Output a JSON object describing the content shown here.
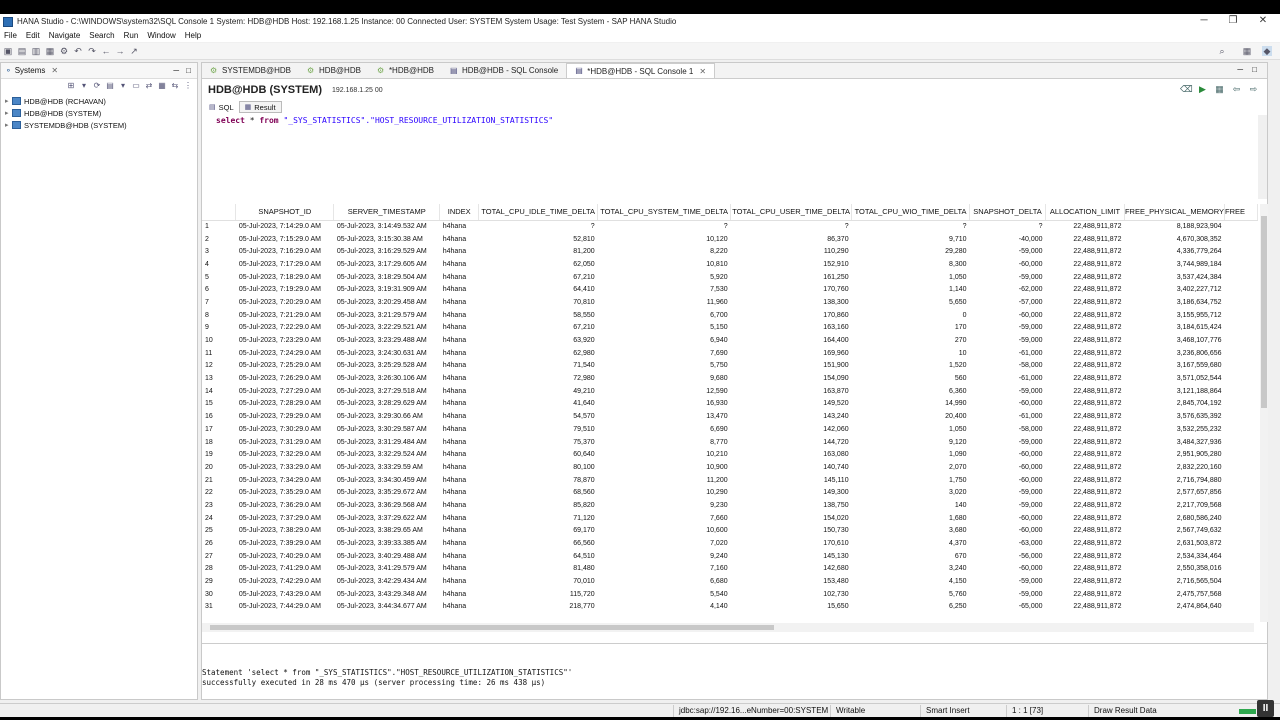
{
  "window": {
    "title": "HANA Studio - C:\\WINDOWS\\system32\\SQL Console 1 System: HDB@HDB Host: 192.168.1.25 Instance: 00 Connected User: SYSTEM System Usage: Test System - SAP HANA Studio",
    "controls": {
      "minimize": "─",
      "restore": "❐",
      "close": "✕"
    }
  },
  "menu": [
    "File",
    "Edit",
    "Navigate",
    "Search",
    "Run",
    "Window",
    "Help"
  ],
  "systems_panel": {
    "title": "Systems",
    "items": [
      "HDB@HDB (RCHAVAN)",
      "HDB@HDB (SYSTEM)",
      "SYSTEMDB@HDB (SYSTEM)"
    ]
  },
  "editor_tabs": [
    {
      "label": "SYSTEMDB@HDB"
    },
    {
      "label": "HDB@HDB"
    },
    {
      "label": "*HDB@HDB"
    },
    {
      "label": "HDB@HDB - SQL Console"
    },
    {
      "label": "*HDB@HDB - SQL Console 1",
      "active": true
    }
  ],
  "console": {
    "system": "HDB@HDB (SYSTEM)",
    "host": "192.168.1.25 00",
    "subtabs": {
      "sql": "SQL",
      "result": "Result"
    },
    "sql": {
      "select": "select",
      "star": " * ",
      "from": "from",
      "target": " \"_SYS_STATISTICS\".\"HOST_RESOURCE_UTILIZATION_STATISTICS\""
    }
  },
  "result": {
    "columns": [
      "SNAPSHOT_ID",
      "SERVER_TIMESTAMP",
      "INDEX",
      "TOTAL_CPU_IDLE_TIME_DELTA",
      "TOTAL_CPU_SYSTEM_TIME_DELTA",
      "TOTAL_CPU_USER_TIME_DELTA",
      "TOTAL_CPU_WIO_TIME_DELTA",
      "SNAPSHOT_DELTA",
      "ALLOCATION_LIMIT",
      "FREE_PHYSICAL_MEMORY",
      "FREE"
    ],
    "rows": [
      [
        "1",
        "05-Jul-2023, 7:14:29.0 AM",
        "05-Jul-2023, 3:14:49.532 AM",
        "h4hana",
        "?",
        "?",
        "?",
        "?",
        "?",
        "22,488,911,872",
        "8,188,923,904"
      ],
      [
        "2",
        "05-Jul-2023, 7:15:29.0 AM",
        "05-Jul-2023, 3:15:30.38 AM",
        "h4hana",
        "52,810",
        "10,120",
        "86,370",
        "9,710",
        "-40,000",
        "22,488,911,872",
        "4,670,308,352"
      ],
      [
        "3",
        "05-Jul-2023, 7:16:29.0 AM",
        "05-Jul-2023, 3:16:29.529 AM",
        "h4hana",
        "81,200",
        "8,220",
        "110,290",
        "29,280",
        "-59,000",
        "22,488,911,872",
        "4,336,779,264"
      ],
      [
        "4",
        "05-Jul-2023, 7:17:29.0 AM",
        "05-Jul-2023, 3:17:29.605 AM",
        "h4hana",
        "62,050",
        "10,810",
        "152,910",
        "8,300",
        "-60,000",
        "22,488,911,872",
        "3,744,989,184"
      ],
      [
        "5",
        "05-Jul-2023, 7:18:29.0 AM",
        "05-Jul-2023, 3:18:29.504 AM",
        "h4hana",
        "67,210",
        "5,920",
        "161,250",
        "1,050",
        "-59,000",
        "22,488,911,872",
        "3,537,424,384"
      ],
      [
        "6",
        "05-Jul-2023, 7:19:29.0 AM",
        "05-Jul-2023, 3:19:31.909 AM",
        "h4hana",
        "64,410",
        "7,530",
        "170,760",
        "1,140",
        "-62,000",
        "22,488,911,872",
        "3,402,227,712"
      ],
      [
        "7",
        "05-Jul-2023, 7:20:29.0 AM",
        "05-Jul-2023, 3:20:29.458 AM",
        "h4hana",
        "70,810",
        "11,960",
        "138,300",
        "5,650",
        "-57,000",
        "22,488,911,872",
        "3,186,634,752"
      ],
      [
        "8",
        "05-Jul-2023, 7:21:29.0 AM",
        "05-Jul-2023, 3:21:29.579 AM",
        "h4hana",
        "58,550",
        "6,700",
        "170,860",
        "0",
        "-60,000",
        "22,488,911,872",
        "3,155,955,712"
      ],
      [
        "9",
        "05-Jul-2023, 7:22:29.0 AM",
        "05-Jul-2023, 3:22:29.521 AM",
        "h4hana",
        "67,210",
        "5,150",
        "163,160",
        "170",
        "-59,000",
        "22,488,911,872",
        "3,184,615,424"
      ],
      [
        "10",
        "05-Jul-2023, 7:23:29.0 AM",
        "05-Jul-2023, 3:23:29.488 AM",
        "h4hana",
        "63,920",
        "6,940",
        "164,400",
        "270",
        "-59,000",
        "22,488,911,872",
        "3,468,107,776"
      ],
      [
        "11",
        "05-Jul-2023, 7:24:29.0 AM",
        "05-Jul-2023, 3:24:30.631 AM",
        "h4hana",
        "62,980",
        "7,690",
        "169,960",
        "10",
        "-61,000",
        "22,488,911,872",
        "3,236,806,656"
      ],
      [
        "12",
        "05-Jul-2023, 7:25:29.0 AM",
        "05-Jul-2023, 3:25:29.528 AM",
        "h4hana",
        "71,540",
        "5,750",
        "151,900",
        "1,520",
        "-58,000",
        "22,488,911,872",
        "3,167,559,680"
      ],
      [
        "13",
        "05-Jul-2023, 7:26:29.0 AM",
        "05-Jul-2023, 3:26:30.106 AM",
        "h4hana",
        "72,980",
        "9,680",
        "154,090",
        "560",
        "-61,000",
        "22,488,911,872",
        "3,571,052,544"
      ],
      [
        "14",
        "05-Jul-2023, 7:27:29.0 AM",
        "05-Jul-2023, 3:27:29.518 AM",
        "h4hana",
        "49,210",
        "12,590",
        "163,870",
        "6,360",
        "-59,000",
        "22,488,911,872",
        "3,121,188,864"
      ],
      [
        "15",
        "05-Jul-2023, 7:28:29.0 AM",
        "05-Jul-2023, 3:28:29.629 AM",
        "h4hana",
        "41,640",
        "16,930",
        "149,520",
        "14,990",
        "-60,000",
        "22,488,911,872",
        "2,845,704,192"
      ],
      [
        "16",
        "05-Jul-2023, 7:29:29.0 AM",
        "05-Jul-2023, 3:29:30.66 AM",
        "h4hana",
        "54,570",
        "13,470",
        "143,240",
        "20,400",
        "-61,000",
        "22,488,911,872",
        "3,576,635,392"
      ],
      [
        "17",
        "05-Jul-2023, 7:30:29.0 AM",
        "05-Jul-2023, 3:30:29.587 AM",
        "h4hana",
        "79,510",
        "6,690",
        "142,060",
        "1,050",
        "-58,000",
        "22,488,911,872",
        "3,532,255,232"
      ],
      [
        "18",
        "05-Jul-2023, 7:31:29.0 AM",
        "05-Jul-2023, 3:31:29.484 AM",
        "h4hana",
        "75,370",
        "8,770",
        "144,720",
        "9,120",
        "-59,000",
        "22,488,911,872",
        "3,484,327,936"
      ],
      [
        "19",
        "05-Jul-2023, 7:32:29.0 AM",
        "05-Jul-2023, 3:32:29.524 AM",
        "h4hana",
        "60,640",
        "10,210",
        "163,080",
        "1,090",
        "-60,000",
        "22,488,911,872",
        "2,951,905,280"
      ],
      [
        "20",
        "05-Jul-2023, 7:33:29.0 AM",
        "05-Jul-2023, 3:33:29.59 AM",
        "h4hana",
        "80,100",
        "10,900",
        "140,740",
        "2,070",
        "-60,000",
        "22,488,911,872",
        "2,832,220,160"
      ],
      [
        "21",
        "05-Jul-2023, 7:34:29.0 AM",
        "05-Jul-2023, 3:34:30.459 AM",
        "h4hana",
        "78,870",
        "11,200",
        "145,110",
        "1,750",
        "-60,000",
        "22,488,911,872",
        "2,716,794,880"
      ],
      [
        "22",
        "05-Jul-2023, 7:35:29.0 AM",
        "05-Jul-2023, 3:35:29.672 AM",
        "h4hana",
        "68,560",
        "10,290",
        "149,300",
        "3,020",
        "-59,000",
        "22,488,911,872",
        "2,577,657,856"
      ],
      [
        "23",
        "05-Jul-2023, 7:36:29.0 AM",
        "05-Jul-2023, 3:36:29.568 AM",
        "h4hana",
        "85,820",
        "9,230",
        "138,750",
        "140",
        "-59,000",
        "22,488,911,872",
        "2,217,709,568"
      ],
      [
        "24",
        "05-Jul-2023, 7:37:29.0 AM",
        "05-Jul-2023, 3:37:29.622 AM",
        "h4hana",
        "71,120",
        "7,660",
        "154,020",
        "1,680",
        "-60,000",
        "22,488,911,872",
        "2,680,586,240"
      ],
      [
        "25",
        "05-Jul-2023, 7:38:29.0 AM",
        "05-Jul-2023, 3:38:29.65 AM",
        "h4hana",
        "69,170",
        "10,600",
        "150,730",
        "3,680",
        "-60,000",
        "22,488,911,872",
        "2,567,749,632"
      ],
      [
        "26",
        "05-Jul-2023, 7:39:29.0 AM",
        "05-Jul-2023, 3:39:33.385 AM",
        "h4hana",
        "66,560",
        "7,020",
        "170,610",
        "4,370",
        "-63,000",
        "22,488,911,872",
        "2,631,503,872"
      ],
      [
        "27",
        "05-Jul-2023, 7:40:29.0 AM",
        "05-Jul-2023, 3:40:29.488 AM",
        "h4hana",
        "64,510",
        "9,240",
        "145,130",
        "670",
        "-56,000",
        "22,488,911,872",
        "2,534,334,464"
      ],
      [
        "28",
        "05-Jul-2023, 7:41:29.0 AM",
        "05-Jul-2023, 3:41:29.579 AM",
        "h4hana",
        "81,480",
        "7,160",
        "142,680",
        "3,240",
        "-60,000",
        "22,488,911,872",
        "2,550,358,016"
      ],
      [
        "29",
        "05-Jul-2023, 7:42:29.0 AM",
        "05-Jul-2023, 3:42:29.434 AM",
        "h4hana",
        "70,010",
        "6,680",
        "153,480",
        "4,150",
        "-59,000",
        "22,488,911,872",
        "2,716,565,504"
      ],
      [
        "30",
        "05-Jul-2023, 7:43:29.0 AM",
        "05-Jul-2023, 3:43:29.348 AM",
        "h4hana",
        "115,720",
        "5,540",
        "102,730",
        "5,760",
        "-59,000",
        "22,488,911,872",
        "2,475,757,568"
      ],
      [
        "31",
        "05-Jul-2023, 7:44:29.0 AM",
        "05-Jul-2023, 3:44:34.677 AM",
        "h4hana",
        "218,770",
        "4,140",
        "15,650",
        "6,250",
        "-65,000",
        "22,488,911,872",
        "2,474,864,640"
      ]
    ]
  },
  "messages": {
    "line1": "Statement 'select * from \"_SYS_STATISTICS\".\"HOST_RESOURCE_UTILIZATION_STATISTICS\"'",
    "line2": "successfully executed in 28 ms 470 µs  (server processing time: 26 ms 438 µs)"
  },
  "status": {
    "connection": "jdbc:sap://192.16...eNumber=00:SYSTEM",
    "mode": "Writable",
    "insert": "Smart Insert",
    "position": "1 : 1 [73]",
    "task": "Draw Result Data"
  },
  "colors": {
    "keyword": "#7f0055",
    "string": "#2a00ff",
    "progress": "#2fa84f"
  }
}
